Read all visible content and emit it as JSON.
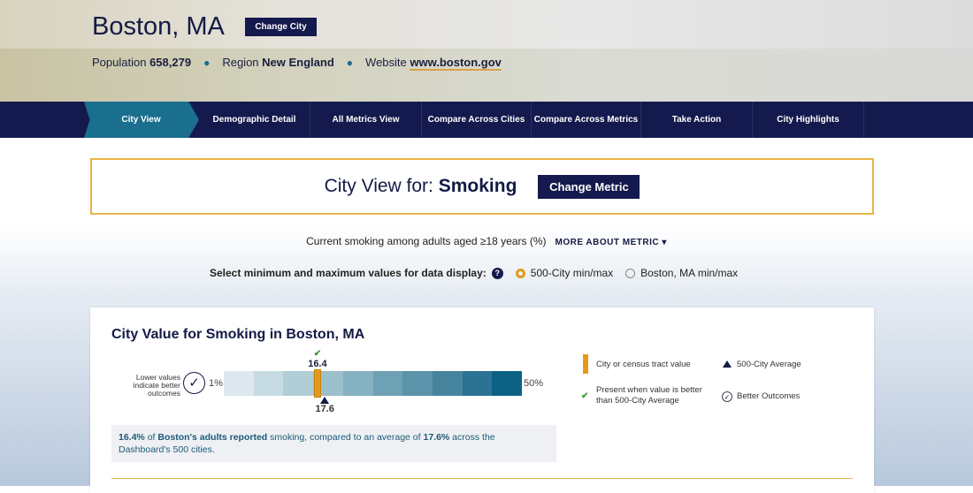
{
  "header": {
    "city": "Boston, MA",
    "change_city": "Change City",
    "population_label": "Population",
    "population": "658,279",
    "region_label": "Region",
    "region": "New England",
    "website_label": "Website",
    "website": "www.boston.gov"
  },
  "nav": [
    "City View",
    "Demographic Detail",
    "All Metrics View",
    "Compare Across Cities",
    "Compare Across Metrics",
    "Take Action",
    "City Highlights"
  ],
  "metric": {
    "prefix": "City View for:",
    "name": "Smoking",
    "change_metric": "Change Metric",
    "description": "Current smoking among adults aged ≥18 years (%)",
    "more": "MORE ABOUT METRIC ▾"
  },
  "select": {
    "label": "Select minimum and maximum values for data display:",
    "help": "?",
    "options": [
      "500-City min/max",
      "Boston, MA min/max"
    ],
    "selected": 0
  },
  "card": {
    "title": "City Value for Smoking in Boston, MA",
    "lower_note": "Lower values indicate better outcomes",
    "min_label": "1%",
    "max_label": "50%",
    "min": 1,
    "max": 50,
    "city_value": 16.4,
    "city_value_label": "16.4",
    "average": 17.6,
    "average_label": "17.6",
    "colors": [
      "#dde9ee",
      "#c6dbe2",
      "#b1cdd7",
      "#9cc0cc",
      "#86b1c1",
      "#6fa1b5",
      "#5a93aa",
      "#46849e",
      "#2c7292",
      "#0c6185"
    ],
    "summary": {
      "v": "16.4%",
      "of": " of ",
      "who": "Boston's adults reported",
      "mid": " smoking, compared to an average of ",
      "avg": "17.6%",
      "end": " across the Dashboard's 500 cities."
    }
  },
  "legend": {
    "value": "City or census tract value",
    "average": "500-City Average",
    "better_line1": "Present when value is better",
    "better_line2": "than 500-City Average",
    "outcomes": "Better Outcomes"
  }
}
